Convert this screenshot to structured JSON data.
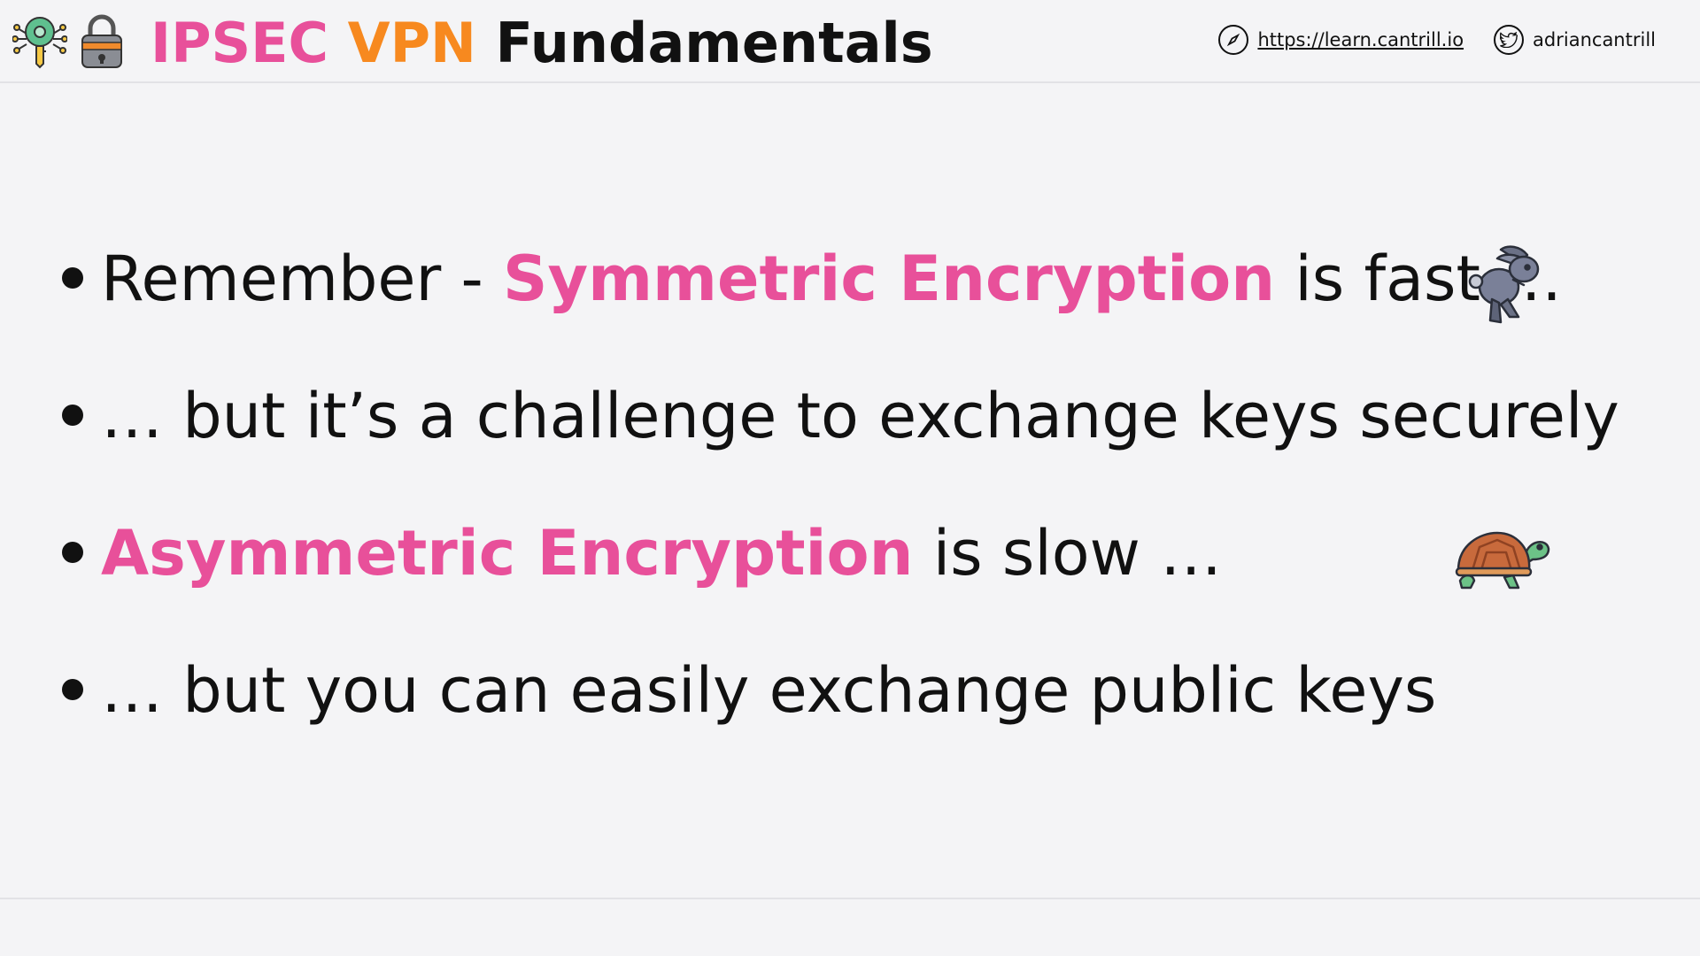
{
  "header": {
    "title_part1": "IPSEC",
    "title_part2": "VPN",
    "title_part3": "Fundamentals",
    "website": "https://learn.cantrill.io",
    "twitter": "adriancantrill",
    "icons": [
      "key-circuit-icon",
      "padlock-icon",
      "compass-icon",
      "twitter-icon"
    ]
  },
  "bullets": [
    {
      "pre": "Remember - ",
      "highlight": "Symmetric Encryption",
      "post": " is fast …",
      "icon": "rabbit-icon"
    },
    {
      "pre": "… but it’s a challenge to exchange keys securely"
    },
    {
      "highlight": "Asymmetric Encryption",
      "post": " is slow …",
      "icon": "turtle-icon"
    },
    {
      "pre": "… but you can easily exchange public keys"
    }
  ],
  "colors": {
    "accent_pink": "#e8509a",
    "accent_orange": "#f7891f",
    "text": "#111111",
    "background": "#f4f4f6"
  }
}
